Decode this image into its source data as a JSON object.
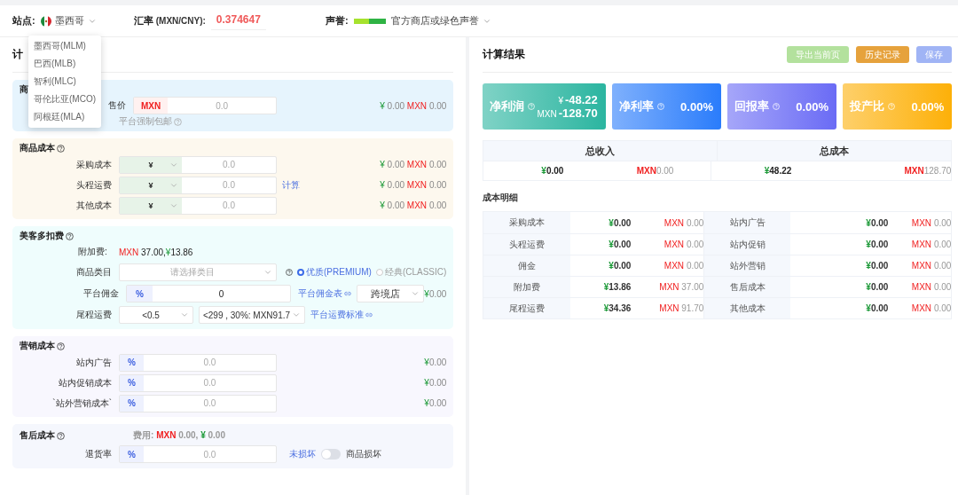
{
  "header": {
    "site_label": "站点:",
    "site": "墨西哥",
    "rate_label": "汇率",
    "rate_unit": "(MXN/CNY):",
    "rate": "0.374647",
    "reputation_label": "声誉:",
    "reputation": "官方商店或绿色声誉"
  },
  "site_menu": [
    "墨西哥(MLM)",
    "巴西(MLB)",
    "智利(MLC)",
    "哥伦比亚(MCO)",
    "阿根廷(MLA)"
  ],
  "calculator": {
    "title": "计"
  },
  "sale": {
    "title": "商",
    "label": "售价",
    "currency": "MXN",
    "placeholder": "0.0",
    "hint": "平台强制包邮",
    "yen": "¥",
    "yen_value": "0.00",
    "mxn": "MXN",
    "mxn_value": "0.00"
  },
  "product_cost": {
    "title": "商品成本",
    "rows": [
      {
        "label": "采购成本",
        "currency": "¥",
        "placeholder": "0.0",
        "yen": "¥",
        "yen_value": "0.00",
        "mxn": "MXN",
        "mxn_value": "0.00"
      },
      {
        "label": "头程运费",
        "currency": "¥",
        "placeholder": "0.0",
        "action": "计算",
        "yen": "¥",
        "yen_value": "0.00",
        "mxn": "MXN",
        "mxn_value": "0.00"
      },
      {
        "label": "其他成本",
        "currency": "¥",
        "placeholder": "0.0",
        "yen": "¥",
        "yen_value": "0.00",
        "mxn": "MXN",
        "mxn_value": "0.00"
      }
    ]
  },
  "fees": {
    "title": "美客多扣费",
    "surcharge_label": "附加费:",
    "surcharge_mxn": "MXN",
    "surcharge_value": "37.00,",
    "surcharge_yen": "¥",
    "surcharge_yen_value": "13.86",
    "category_label": "商品类目",
    "category_placeholder": "请选择类目",
    "radios": [
      {
        "label": "优质(PREMIUM)",
        "selected": true
      },
      {
        "label": "经典(CLASSIC)",
        "selected": false
      }
    ],
    "commission_label": "平台佣金",
    "commission_unit": "%",
    "commission_value": "0",
    "commission_link": "平台佣金表",
    "store": "跨境店",
    "commission_yen": "¥",
    "commission_result": "0.00",
    "shipping_label": "尾程运费",
    "weight": "<0.5",
    "tier": "<299 , 30%: MXN91.7",
    "shipping_link": "平台运费标准"
  },
  "marketing": {
    "title": "营销成本",
    "rows": [
      {
        "label": "站内广告",
        "unit": "%",
        "placeholder": "0.0",
        "yen": "¥",
        "result": "0.00"
      },
      {
        "label": "站内促销成本",
        "unit": "%",
        "placeholder": "0.0",
        "yen": "¥",
        "result": "0.00"
      },
      {
        "label": "`站外营销成本`",
        "unit": "%",
        "placeholder": "0.0",
        "yen": "¥",
        "result": "0.00"
      }
    ]
  },
  "after_sales": {
    "title": "售后成本",
    "fee_label": "费用:",
    "fee_mxn": "MXN",
    "fee_mxn_value": "0.00,",
    "fee_yen": "¥",
    "fee_yen_value": "0.00",
    "rate_label": "退货率",
    "unit": "%",
    "placeholder": "0.0",
    "off_label": "未损坏",
    "on_label": "商品损坏",
    "damaged": false
  },
  "results": {
    "title": "计算结果",
    "buttons": [
      {
        "label": "导出当前页",
        "color": "#b3e19d"
      },
      {
        "label": "历史记录",
        "color": "#e6a23c"
      },
      {
        "label": "保存",
        "color": "#a0b4f5"
      }
    ],
    "kpis": [
      {
        "label": "净利润",
        "kind": "dual",
        "color": "#2bb5a0",
        "yen": "¥",
        "yen_value": "-48.22",
        "mxn": "MXN",
        "mxn_value": "-128.70"
      },
      {
        "label": "净利率",
        "kind": "single",
        "color": "#2a7cfb",
        "value": "0.00%"
      },
      {
        "label": "回报率",
        "kind": "single",
        "color": "#6a6bf5",
        "value": "0.00%"
      },
      {
        "label": "投产比",
        "kind": "single",
        "color": "#fdb008",
        "value": "0.00%"
      }
    ],
    "totals": [
      {
        "title": "总收入",
        "yen": "¥",
        "yen_value": "0.00",
        "mxn": "MXN",
        "mxn_value": "0.00"
      },
      {
        "title": "总成本",
        "yen": "¥",
        "yen_value": "48.22",
        "mxn": "MXN",
        "mxn_value": "128.70"
      }
    ],
    "detail_title": "成本明细",
    "detail_rows": [
      [
        {
          "label": "采购成本",
          "yen": "¥",
          "yen_value": "0.00",
          "mxn": "MXN",
          "mxn_value": "0.00"
        },
        {
          "label": "站内广告",
          "yen": "¥",
          "yen_value": "0.00",
          "mxn": "MXN",
          "mxn_value": "0.00"
        }
      ],
      [
        {
          "label": "头程运费",
          "yen": "¥",
          "yen_value": "0.00",
          "mxn": "MXN",
          "mxn_value": "0.00"
        },
        {
          "label": "站内促销",
          "yen": "¥",
          "yen_value": "0.00",
          "mxn": "MXN",
          "mxn_value": "0.00"
        }
      ],
      [
        {
          "label": "佣金",
          "yen": "¥",
          "yen_value": "0.00",
          "mxn": "MXN",
          "mxn_value": "0.00"
        },
        {
          "label": "站外营销",
          "yen": "¥",
          "yen_value": "0.00",
          "mxn": "MXN",
          "mxn_value": "0.00"
        }
      ],
      [
        {
          "label": "附加费",
          "yen": "¥",
          "yen_value": "13.86",
          "mxn": "MXN",
          "mxn_value": "37.00"
        },
        {
          "label": "售后成本",
          "yen": "¥",
          "yen_value": "0.00",
          "mxn": "MXN",
          "mxn_value": "0.00"
        }
      ],
      [
        {
          "label": "尾程运费",
          "yen": "¥",
          "yen_value": "34.36",
          "mxn": "MXN",
          "mxn_value": "91.70"
        },
        {
          "label": "其他成本",
          "yen": "¥",
          "yen_value": "0.00",
          "mxn": "MXN",
          "mxn_value": "0.00"
        }
      ]
    ]
  }
}
